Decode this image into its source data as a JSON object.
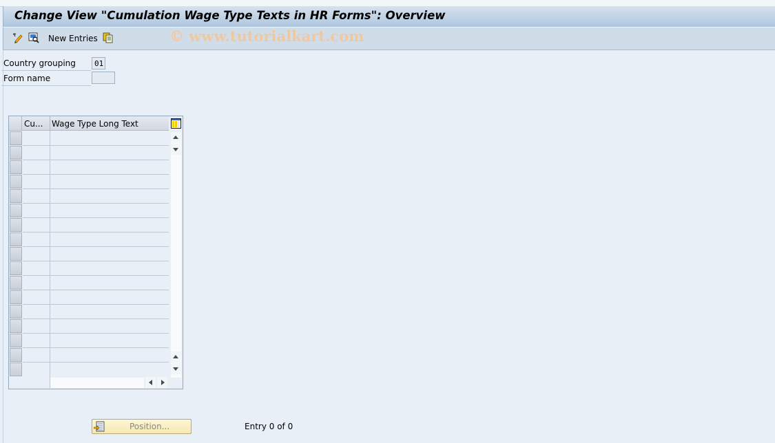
{
  "window": {
    "title": "Change View \"Cumulation Wage Type Texts in HR Forms\": Overview"
  },
  "toolbar": {
    "items": [
      {
        "icon": "display-change-icon"
      },
      {
        "icon": "details-icon"
      },
      {
        "label": "New Entries"
      },
      {
        "icon": "copy-icon"
      }
    ],
    "new_entries_label": "New Entries"
  },
  "watermark": "© www.tutorialkart.com",
  "fields": {
    "country_grouping": {
      "label": "Country grouping",
      "value": "01"
    },
    "form_name": {
      "label": "Form name",
      "value": ""
    }
  },
  "table": {
    "columns": [
      "Cu...",
      "Wage Type Long Text"
    ],
    "rows": [
      [
        "",
        ""
      ],
      [
        "",
        ""
      ],
      [
        "",
        ""
      ],
      [
        "",
        ""
      ],
      [
        "",
        ""
      ],
      [
        "",
        ""
      ],
      [
        "",
        ""
      ],
      [
        "",
        ""
      ],
      [
        "",
        ""
      ],
      [
        "",
        ""
      ],
      [
        "",
        ""
      ],
      [
        "",
        ""
      ],
      [
        "",
        ""
      ],
      [
        "",
        ""
      ],
      [
        "",
        ""
      ],
      [
        "",
        ""
      ],
      [
        "",
        ""
      ]
    ],
    "settings_icon": "column-settings-icon"
  },
  "footer": {
    "position_button": "Position...",
    "entry_status": "Entry 0 of 0"
  },
  "colors": {
    "background": "#e8eff7",
    "title_bar": "#afc6dd",
    "toolbar": "#d0dde8",
    "position_button": "#f7e9b0",
    "watermark": "#f0c8a0"
  }
}
